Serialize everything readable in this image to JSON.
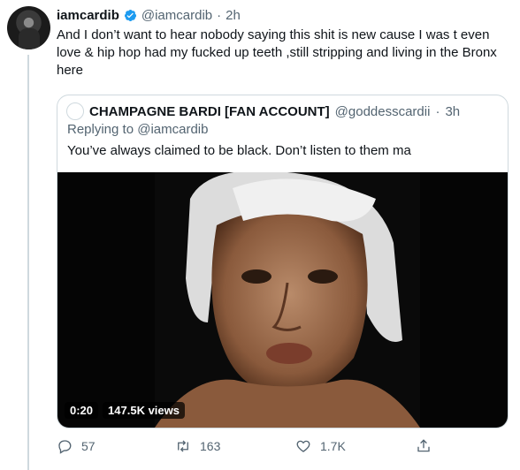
{
  "tweet": {
    "display_name": "iamcardib",
    "handle": "@iamcardib",
    "dot": "·",
    "time": "2h",
    "text": "And I don’t want to hear nobody saying this shit is new cause I was t even\nlove & hip hop had my fucked up teeth ,still stripping and living in the Bronx\nhere"
  },
  "quote": {
    "display_name": "CHAMPAGNE BARDI [FAN ACCOUNT]",
    "handle": "@goddesscardii",
    "dot": "·",
    "time": "3h",
    "replying_prefix": "Replying to",
    "replying_to": "@iamcardib",
    "text": "You’ve always claimed to be black. Don’t listen to them ma",
    "media": {
      "duration": "0:20",
      "views": "147.5K views"
    }
  },
  "actions": {
    "reply_count": "57",
    "retweet_count": "163",
    "like_count": "1.7K"
  },
  "colors": {
    "verified": "#1d9bf0",
    "secondary_text": "#536471",
    "border": "#cfd9de"
  },
  "icons": [
    "verified-badge-icon",
    "reply-icon",
    "retweet-icon",
    "like-icon",
    "share-icon"
  ]
}
